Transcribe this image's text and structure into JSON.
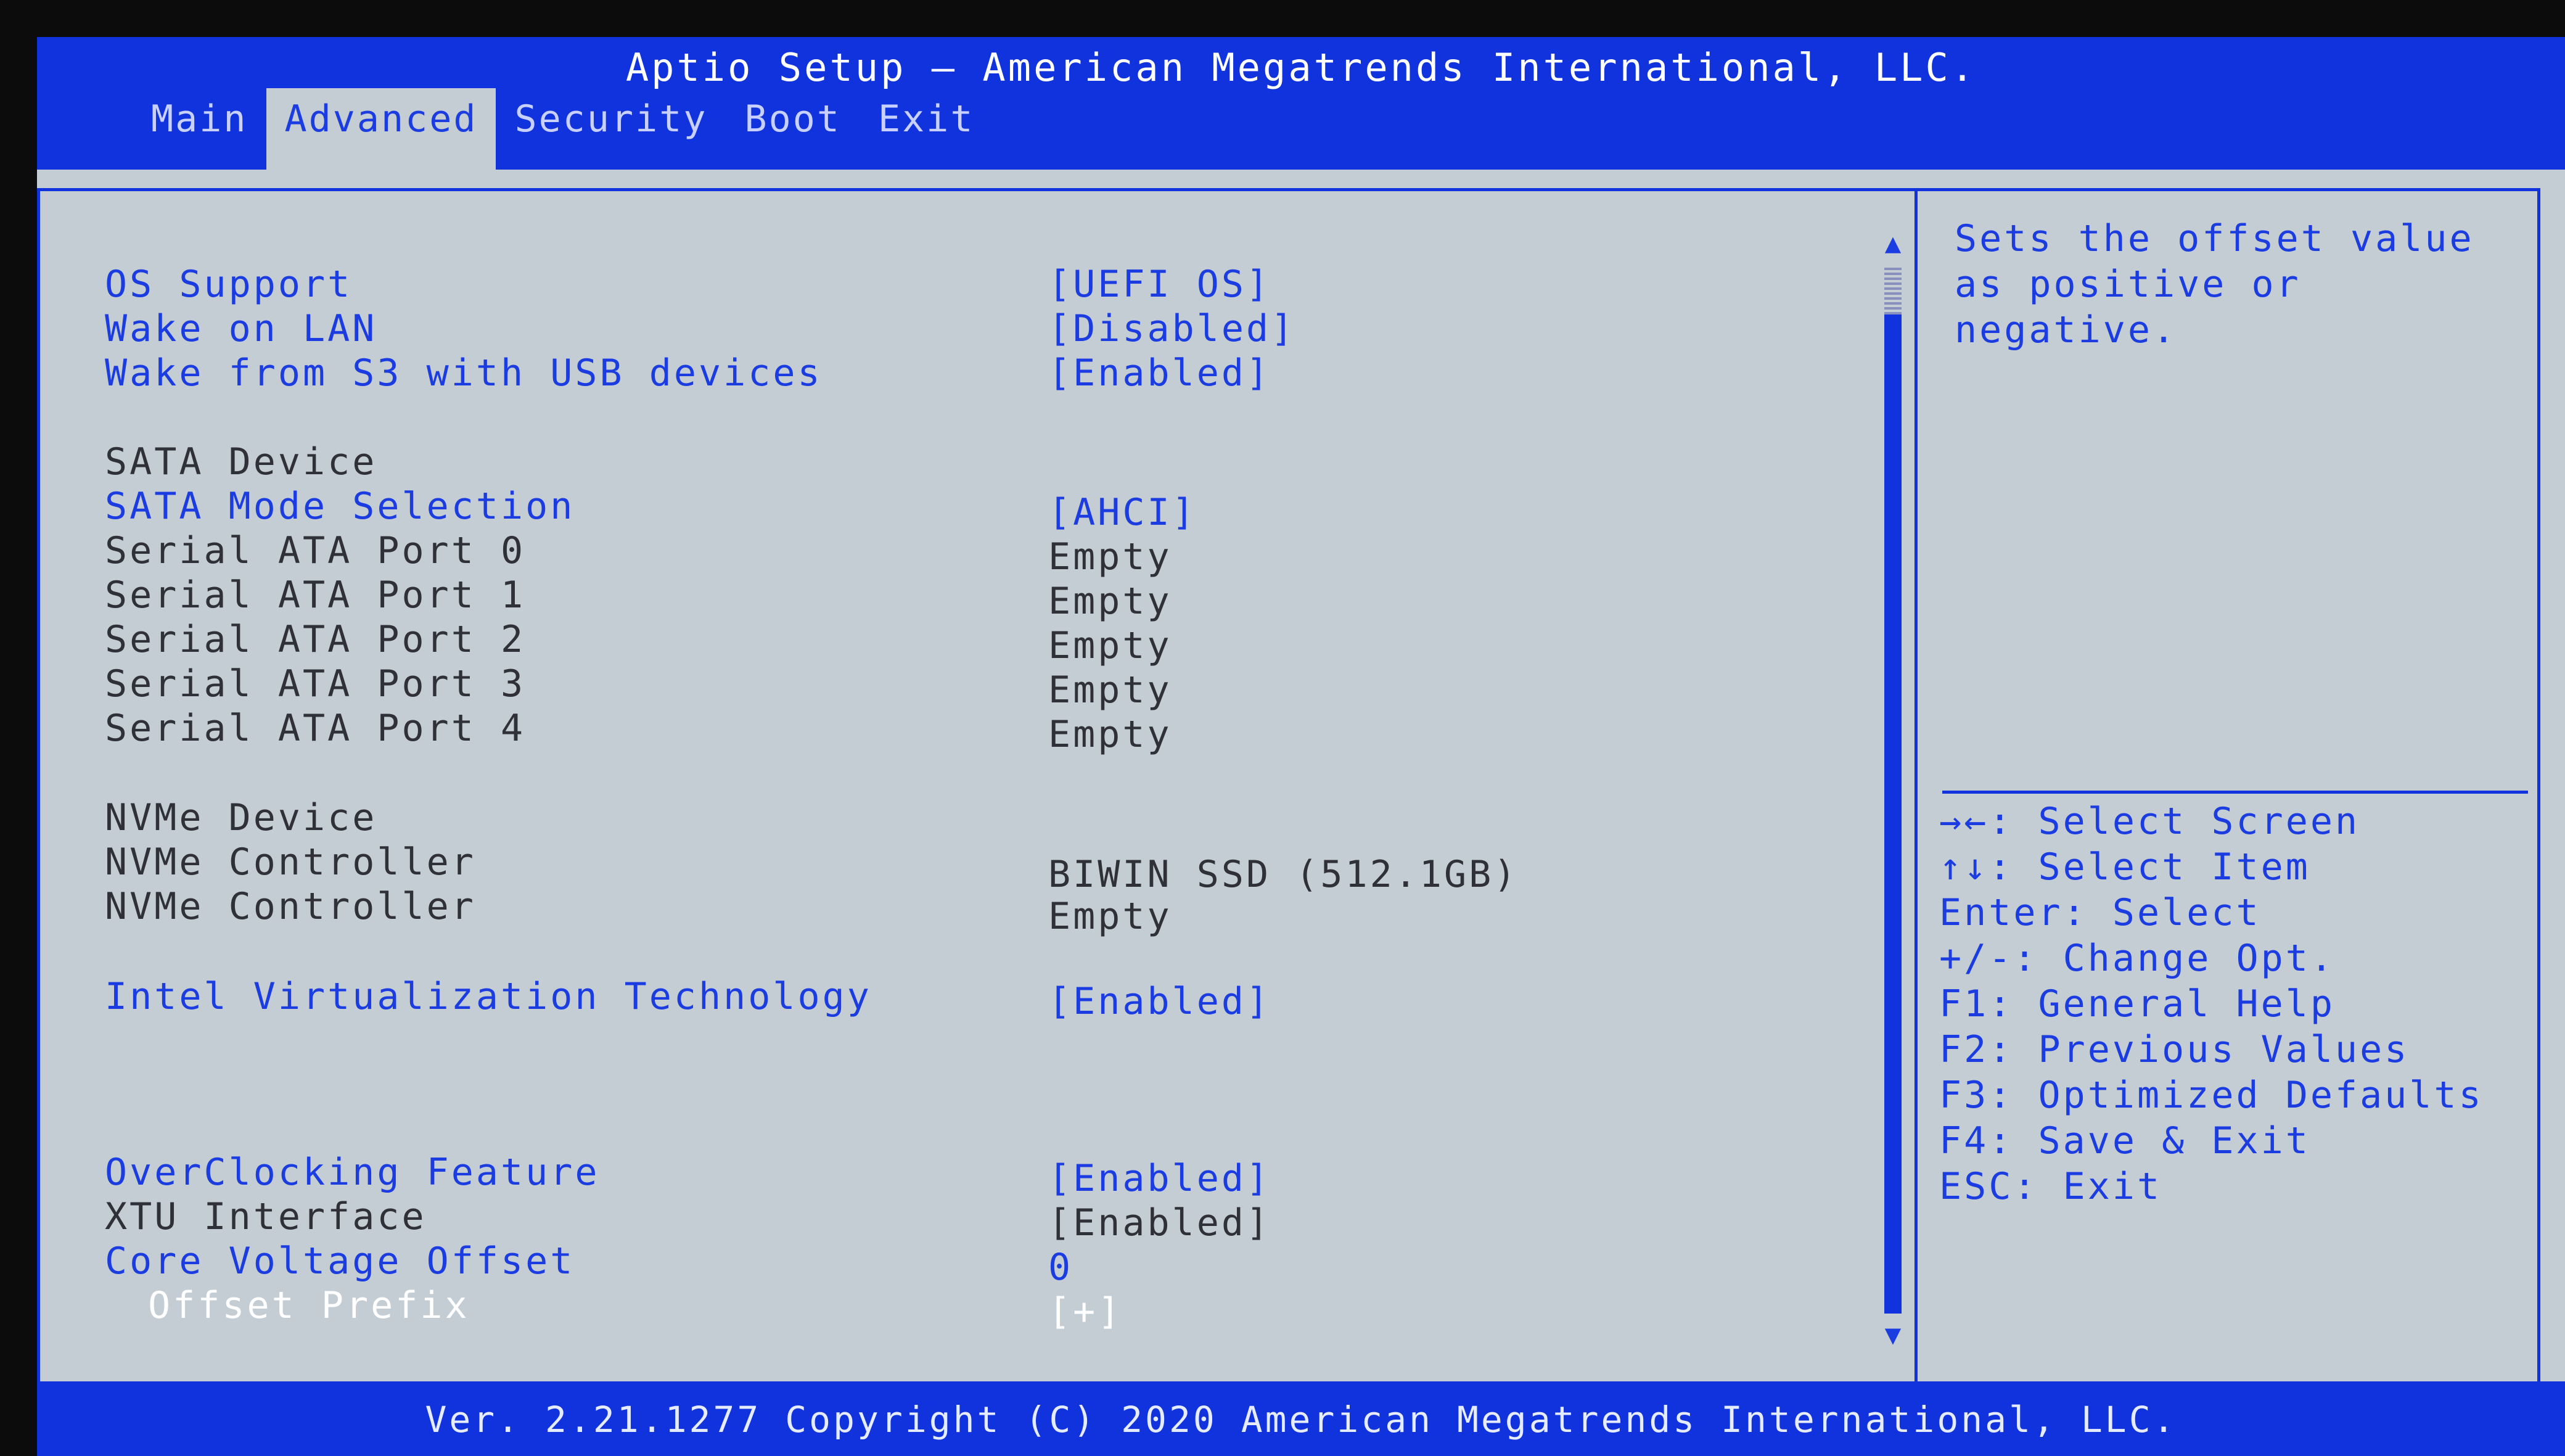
{
  "header": {
    "title": "Aptio Setup – American Megatrends International, LLC.",
    "tabs": [
      {
        "label": "Main"
      },
      {
        "label": "Advanced"
      },
      {
        "label": "Security"
      },
      {
        "label": "Boot"
      },
      {
        "label": "Exit"
      }
    ]
  },
  "settings": [
    {
      "label": "OS Support",
      "value": "[UEFI OS]"
    },
    {
      "label": "Wake on LAN",
      "value": "[Disabled]"
    },
    {
      "label": "Wake from S3 with USB devices",
      "value": "[Enabled]"
    },
    {
      "label": "SATA Device",
      "value": ""
    },
    {
      "label": "SATA Mode Selection",
      "value": "[AHCI]"
    },
    {
      "label": "Serial ATA Port 0",
      "value": "Empty"
    },
    {
      "label": "Serial ATA Port 1",
      "value": "Empty"
    },
    {
      "label": "Serial ATA Port 2",
      "value": "Empty"
    },
    {
      "label": "Serial ATA Port 3",
      "value": "Empty"
    },
    {
      "label": "Serial ATA Port 4",
      "value": "Empty"
    },
    {
      "label": "NVMe Device",
      "value": ""
    },
    {
      "label": "NVMe Controller",
      "value": "BIWIN SSD (512.1GB)"
    },
    {
      "label": "NVMe Controller",
      "value": "Empty"
    },
    {
      "label": "Intel Virtualization Technology",
      "value": "[Enabled]"
    },
    {
      "label": "OverClocking Feature",
      "value": "[Enabled]"
    },
    {
      "label": "XTU Interface",
      "value": "[Enabled]"
    },
    {
      "label": "Core Voltage Offset",
      "value": "0"
    },
    {
      "label": "Offset Prefix",
      "value": "[+]"
    }
  ],
  "help": {
    "lines": [
      "Sets the offset value",
      "as positive or",
      "negative."
    ]
  },
  "keys": [
    "→←: Select Screen",
    "↑↓: Select Item",
    "Enter: Select",
    "+/-: Change Opt.",
    "F1: General Help",
    "F2: Previous Values",
    "F3: Optimized Defaults",
    "F4: Save & Exit",
    "ESC: Exit"
  ],
  "scrollbar": {
    "up_glyph": "▲",
    "down_glyph": "▼"
  },
  "footer": {
    "text": "Ver. 2.21.1277 Copyright (C) 2020 American Megatrends International, LLC."
  },
  "colors": {
    "bios_blue": "#1133dd",
    "panel_gray": "#c4ccd4",
    "text_blue": "#1a3ce0",
    "text_dark": "#303038"
  }
}
